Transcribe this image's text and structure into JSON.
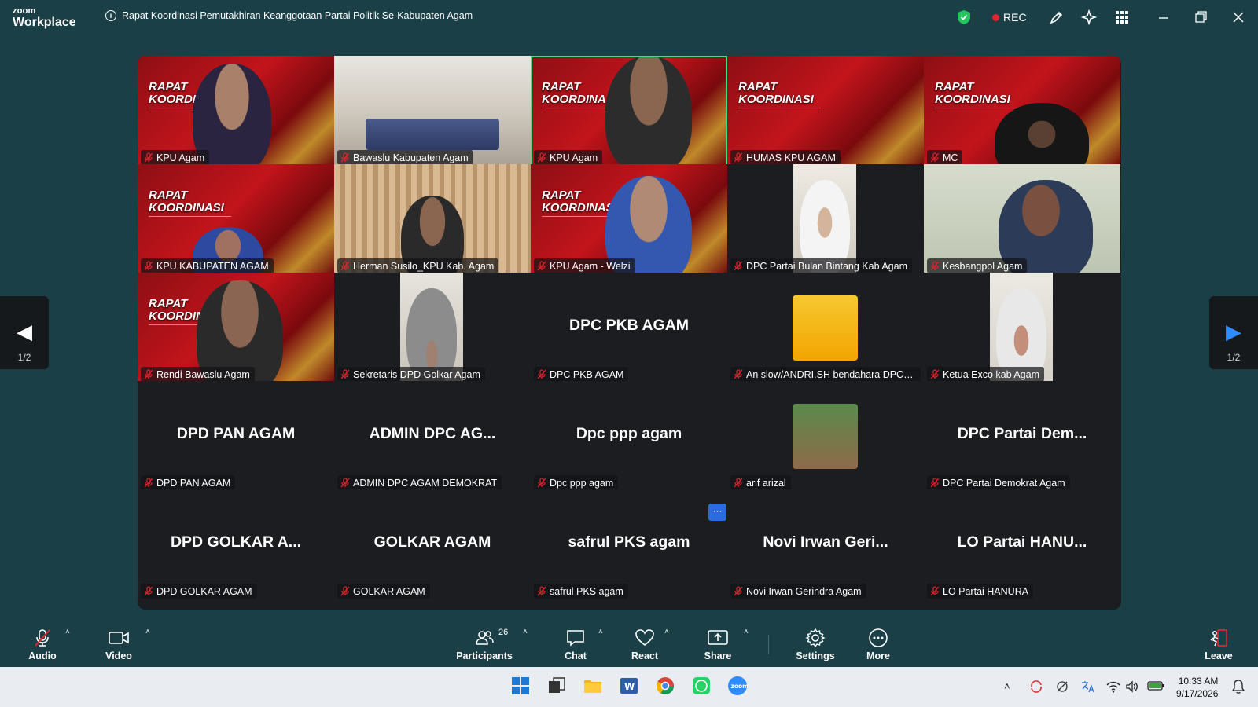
{
  "app": {
    "logo_top": "zoom",
    "logo_bottom": "Workplace",
    "meeting_title": "Rapat Koordinasi Pemutakhiran Keanggotaan Partai Politik Se-Kabupaten Agam",
    "rec_label": "REC"
  },
  "banner_text": {
    "line1": "RAPAT",
    "line2": "KOORDINASI"
  },
  "tiles": [
    {
      "name": "KPU Agam",
      "kind": "video"
    },
    {
      "name": "Bawaslu Kabupaten Agam",
      "kind": "video"
    },
    {
      "name": "KPU Agam",
      "kind": "video",
      "active": true
    },
    {
      "name": "HUMAS KPU AGAM",
      "kind": "video"
    },
    {
      "name": "MC",
      "kind": "video"
    },
    {
      "name": "KPU KABUPATEN AGAM",
      "kind": "video"
    },
    {
      "name": "Herman Susilo_KPU Kab. Agam",
      "kind": "video"
    },
    {
      "name": "KPU Agam - Welzi",
      "kind": "video"
    },
    {
      "name": "DPC Partai Bulan Bintang Kab Agam",
      "kind": "video"
    },
    {
      "name": "Kesbangpol Agam",
      "kind": "video"
    },
    {
      "name": "Rendi Bawaslu Agam",
      "kind": "video"
    },
    {
      "name": "Sekretaris DPD Golkar Agam",
      "kind": "video"
    },
    {
      "name": "DPC PKB AGAM",
      "kind": "name",
      "display": "DPC PKB AGAM"
    },
    {
      "name": "An slow/ANDRI.SH bendahara DPC D...",
      "kind": "photo"
    },
    {
      "name": "Ketua Exco kab Agam",
      "kind": "video"
    },
    {
      "name": "DPD PAN AGAM",
      "kind": "name",
      "display": "DPD PAN AGAM"
    },
    {
      "name": "ADMIN DPC AGAM DEMOKRAT",
      "kind": "name",
      "display": "ADMIN DPC AG..."
    },
    {
      "name": "Dpc ppp agam",
      "kind": "name",
      "display": "Dpc ppp agam"
    },
    {
      "name": "arif arizal",
      "kind": "photo"
    },
    {
      "name": "DPC Partai Demokrat Agam",
      "kind": "name",
      "display": "DPC Partai Dem..."
    },
    {
      "name": "DPD GOLKAR AGAM",
      "kind": "name",
      "display": "DPD GOLKAR A..."
    },
    {
      "name": "GOLKAR AGAM",
      "kind": "name",
      "display": "GOLKAR AGAM"
    },
    {
      "name": "safrul PKS agam",
      "kind": "name",
      "display": "safrul PKS agam"
    },
    {
      "name": "Novi Irwan Gerindra Agam",
      "kind": "name",
      "display": "Novi Irwan Geri..."
    },
    {
      "name": "LO Partai HANURA",
      "kind": "name",
      "display": "LO Partai HANU..."
    }
  ],
  "pager": {
    "left_label": "1/2",
    "right_label": "1/2"
  },
  "more_dots": "···",
  "toolbar": {
    "audio": "Audio",
    "video": "Video",
    "participants": "Participants",
    "participants_count": "26",
    "chat": "Chat",
    "react": "React",
    "share": "Share",
    "settings": "Settings",
    "more": "More",
    "leave": "Leave"
  },
  "taskbar": {
    "time": "10:33 AM",
    "date": "9/17/2026"
  },
  "colors": {
    "window_bg": "#1a3f47",
    "gallery_bg": "#1c1d20",
    "active_speaker": "#3fe07f",
    "rec_red": "#e0242d",
    "accent_blue": "#2f8cff"
  }
}
